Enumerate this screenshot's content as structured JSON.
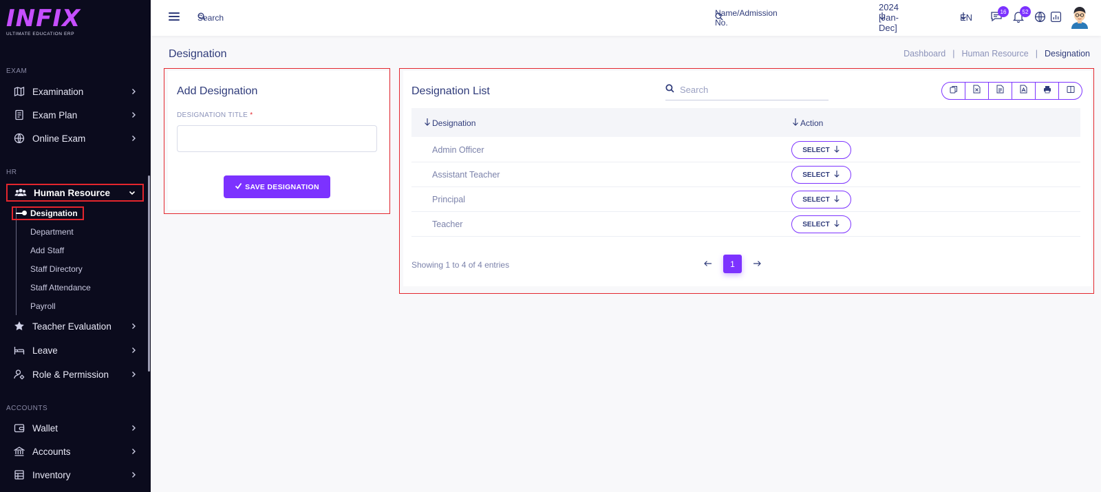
{
  "logo": {
    "word": "INFIX",
    "subtitle": "ULTIMATE EDUCATION ERP"
  },
  "sidebar": {
    "sections": {
      "exam": "EXAM",
      "hr": "HR",
      "accounts": "ACCOUNTS"
    },
    "items": {
      "examination": "Examination",
      "exam_plan": "Exam Plan",
      "online_exam": "Online Exam",
      "human_resource": "Human Resource",
      "teacher_evaluation": "Teacher Evaluation",
      "leave": "Leave",
      "role_permission": "Role & Permission",
      "wallet": "Wallet",
      "accounts": "Accounts",
      "inventory": "Inventory"
    },
    "hr_sub": {
      "designation": "Designation",
      "department": "Department",
      "add_staff": "Add Staff",
      "staff_directory": "Staff Directory",
      "staff_attendance": "Staff Attendance",
      "payroll": "Payroll"
    }
  },
  "header": {
    "search": "Search",
    "student_search": "Name/Admission No.",
    "session": "2024 [Jan-Dec]",
    "language": "EN",
    "messages_count": "16",
    "notifications_count": "52"
  },
  "page": {
    "title": "Designation",
    "breadcrumb": {
      "dashboard": "Dashboard",
      "sep": "|",
      "hr": "Human Resource",
      "current": "Designation"
    }
  },
  "add_form": {
    "title": "Add Designation",
    "field_label": "DESIGNATION TITLE",
    "required_mark": "*",
    "field_value": "",
    "save_label": "SAVE DESIGNATION"
  },
  "list": {
    "title": "Designation List",
    "search_placeholder": "Search",
    "columns": {
      "designation": "Designation",
      "action": "Action"
    },
    "rows": [
      {
        "name": "Admin Officer",
        "action": "SELECT"
      },
      {
        "name": "Assistant Teacher",
        "action": "SELECT"
      },
      {
        "name": "Principal",
        "action": "SELECT"
      },
      {
        "name": "Teacher",
        "action": "SELECT"
      }
    ],
    "info": "Showing 1 to 4 of 4 entries",
    "page": "1"
  },
  "colors": {
    "accent": "#7c32ff",
    "sidebar_bg": "#0b0b1d",
    "highlight": "#e4262d",
    "text_dark": "#2f3b7a"
  }
}
